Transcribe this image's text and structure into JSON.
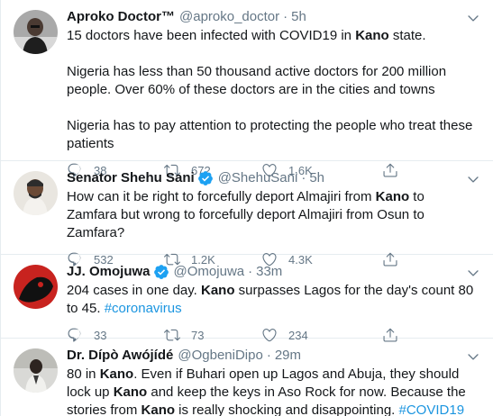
{
  "tweets": [
    {
      "name": "Aproko Doctor™",
      "handle": "@aproko_doctor",
      "time": "5h",
      "verified": false,
      "paragraphs": [
        [
          {
            "t": "15 doctors have been infected with COVID19 in "
          },
          {
            "t": "Kano",
            "b": true
          },
          {
            "t": " state."
          }
        ],
        [
          {
            "t": "Nigeria has less than 50 thousand active doctors for 200 million people. Over 60% of these doctors are in the cities and towns"
          }
        ],
        [
          {
            "t": "Nigeria has to pay attention to protecting the people who treat these patients"
          }
        ]
      ],
      "replies": "38",
      "retweets": "672",
      "likes": "1.6K"
    },
    {
      "name": "Senator Shehu Sani",
      "handle": "@ShehuSani",
      "time": "5h",
      "verified": true,
      "paragraphs": [
        [
          {
            "t": "How can it be right to forcefully deport Almajiri from "
          },
          {
            "t": "Kano",
            "b": true
          },
          {
            "t": " to Zamfara but wrong to forcefully deport Almajiri from Osun to Zamfara?"
          }
        ]
      ],
      "replies": "532",
      "retweets": "1.2K",
      "likes": "4.3K"
    },
    {
      "name": "JJ. Omojuwa",
      "handle": "@Omojuwa",
      "time": "33m",
      "verified": true,
      "paragraphs": [
        [
          {
            "t": "204 cases in one day. "
          },
          {
            "t": "Kano",
            "b": true
          },
          {
            "t": " surpasses Lagos for the day's count 80 to 45. "
          },
          {
            "t": "#coronavirus",
            "h": true
          }
        ]
      ],
      "replies": "33",
      "retweets": "73",
      "likes": "234"
    },
    {
      "name": "Dr. Dípò Awójídé",
      "handle": "@OgbeniDipo",
      "time": "29m",
      "verified": false,
      "paragraphs": [
        [
          {
            "t": "80 in "
          },
          {
            "t": "Kano",
            "b": true
          },
          {
            "t": ". Even if Buhari open up Lagos and Abuja, they should lock up "
          },
          {
            "t": "Kano",
            "b": true
          },
          {
            "t": " and keep the keys in Aso Rock for now. Because the stories from "
          },
          {
            "t": "Kano",
            "b": true
          },
          {
            "t": " is really shocking and disappointing. "
          },
          {
            "t": "#COVID19",
            "h": true
          }
        ]
      ],
      "replies": "",
      "retweets": "",
      "likes": ""
    }
  ],
  "icons": {
    "reply": "reply-icon",
    "retweet": "retweet-icon",
    "like": "heart-icon",
    "share": "share-icon",
    "more": "chevron-down-icon",
    "verified": "verified-badge-icon"
  },
  "colors": {
    "text": "#14171a",
    "muted": "#657786",
    "link": "#1b95e0",
    "verified": "#1da1f2",
    "divider": "#e6ecf0"
  }
}
